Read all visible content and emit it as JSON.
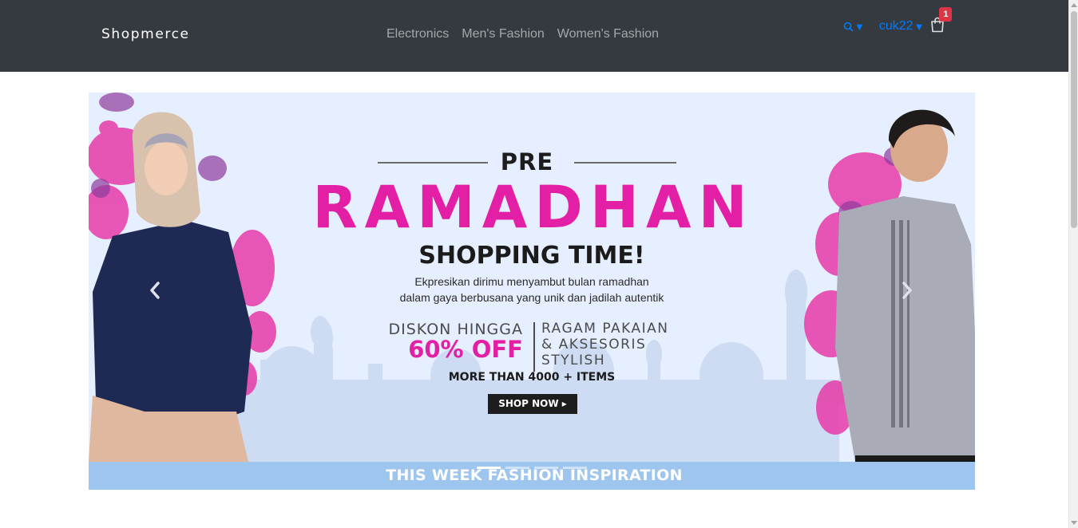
{
  "brand": "Shopmerce",
  "nav": {
    "links": [
      "Electronics",
      "Men's Fashion",
      "Women's Fashion"
    ]
  },
  "user": {
    "name": "cuk22",
    "cart_count": "1"
  },
  "icons": {
    "search": "search-icon",
    "caret": "caret-down-icon",
    "cart": "shopping-bag-icon",
    "prev": "chevron-left-icon",
    "next": "chevron-right-icon"
  },
  "colors": {
    "navbar": "#343a40",
    "link": "#007bff",
    "badge": "#dc3545",
    "accent_pink": "#e21fa5"
  },
  "banner": {
    "pre": "PRE",
    "title": "RAMADHAN",
    "subtitle": "SHOPPING TIME!",
    "desc_1": "Ekpresikan dirimu menyambut bulan ramadhan",
    "desc_2": "dalam gaya berbusana yang unik dan jadilah autentik",
    "diskon": "DISKON HINGGA",
    "off": "60% OFF",
    "ragam_1": "RAGAM PAKAIAN",
    "ragam_2": "& AKSESORIS",
    "ragam_3": "STYLISH",
    "more": "MORE THAN 4000 + ITEMS",
    "cta": "SHOP NOW ▸",
    "footer": "THIS WEEK FASHION INSPIRATION"
  },
  "carousel": {
    "slides": 4,
    "active_index": 0
  }
}
